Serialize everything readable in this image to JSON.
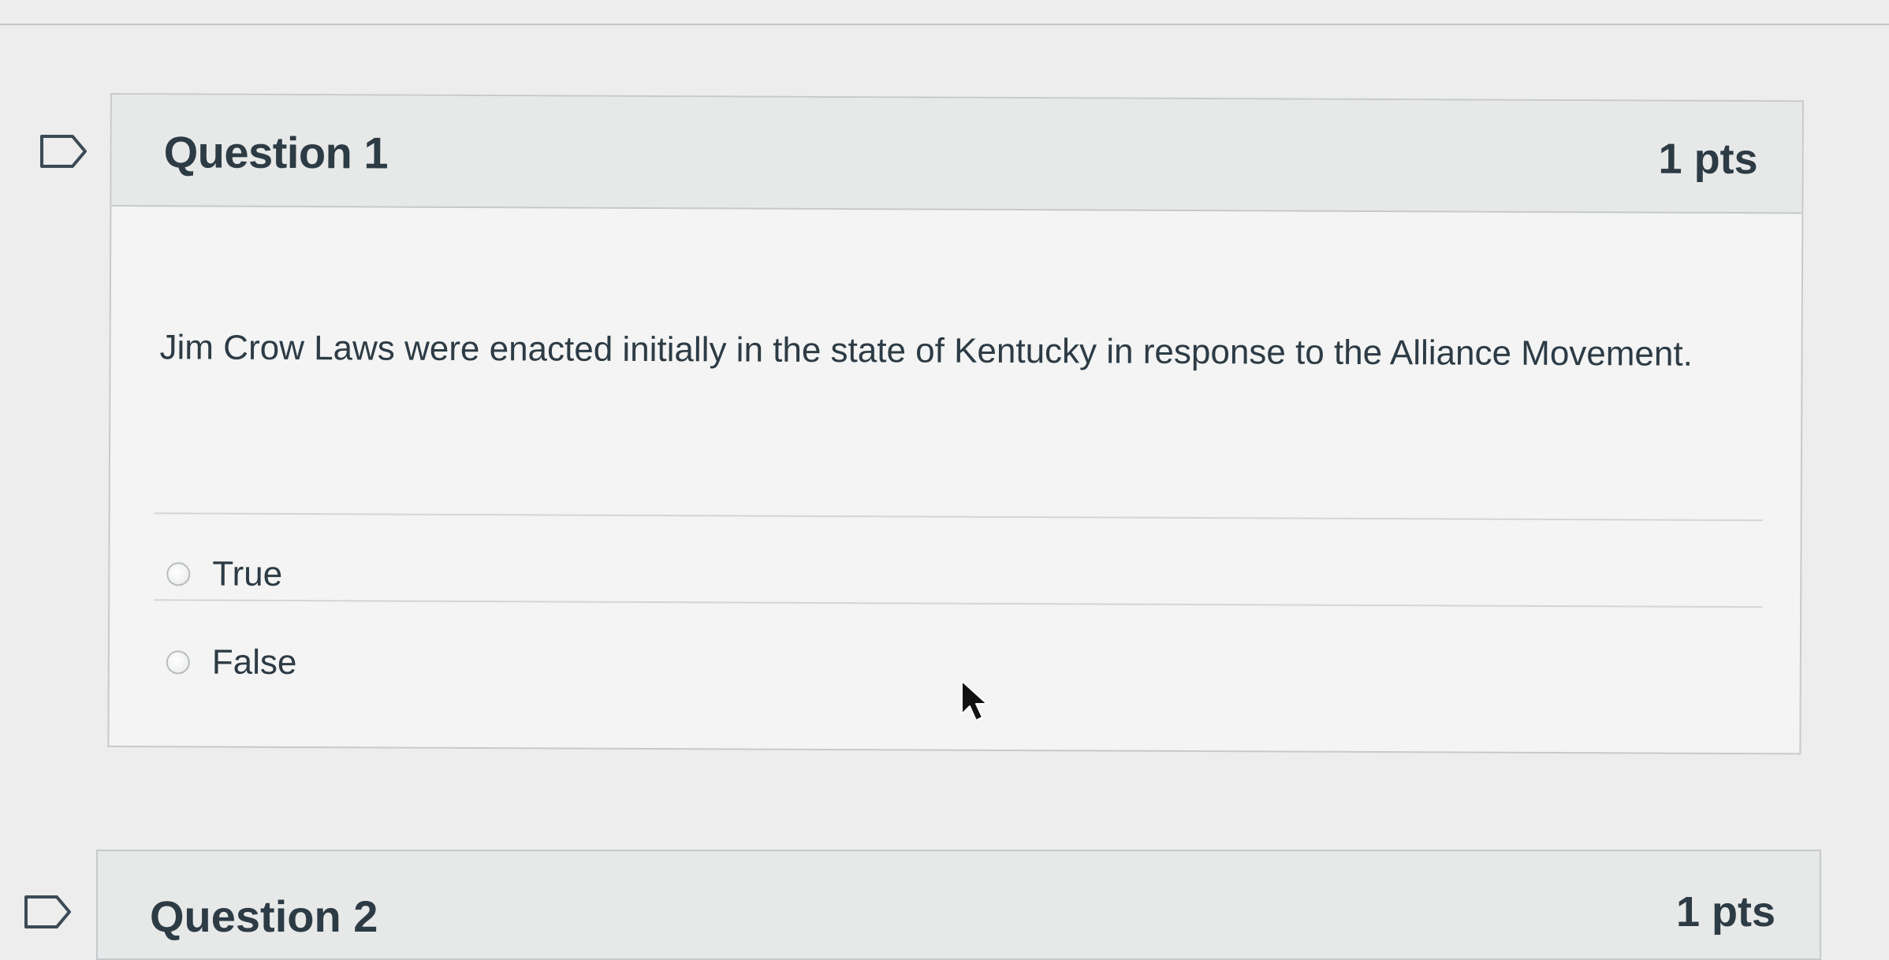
{
  "question1": {
    "title": "Question 1",
    "points": "1 pts",
    "text": "Jim Crow Laws were enacted initially in the state of Kentucky in response to the Alliance Movement.",
    "answers": [
      {
        "label": "True",
        "selected": false
      },
      {
        "label": "False",
        "selected": false
      }
    ]
  },
  "question2": {
    "title": "Question 2",
    "points": "1 pts"
  },
  "icons": {
    "flag": "flag-icon",
    "radio": "radio-button",
    "cursor": "mouse-pointer-icon"
  },
  "colors": {
    "background": "#ecedec",
    "header": "#e7e9e8",
    "text": "#2d3b45",
    "border": "#c7cacc"
  }
}
